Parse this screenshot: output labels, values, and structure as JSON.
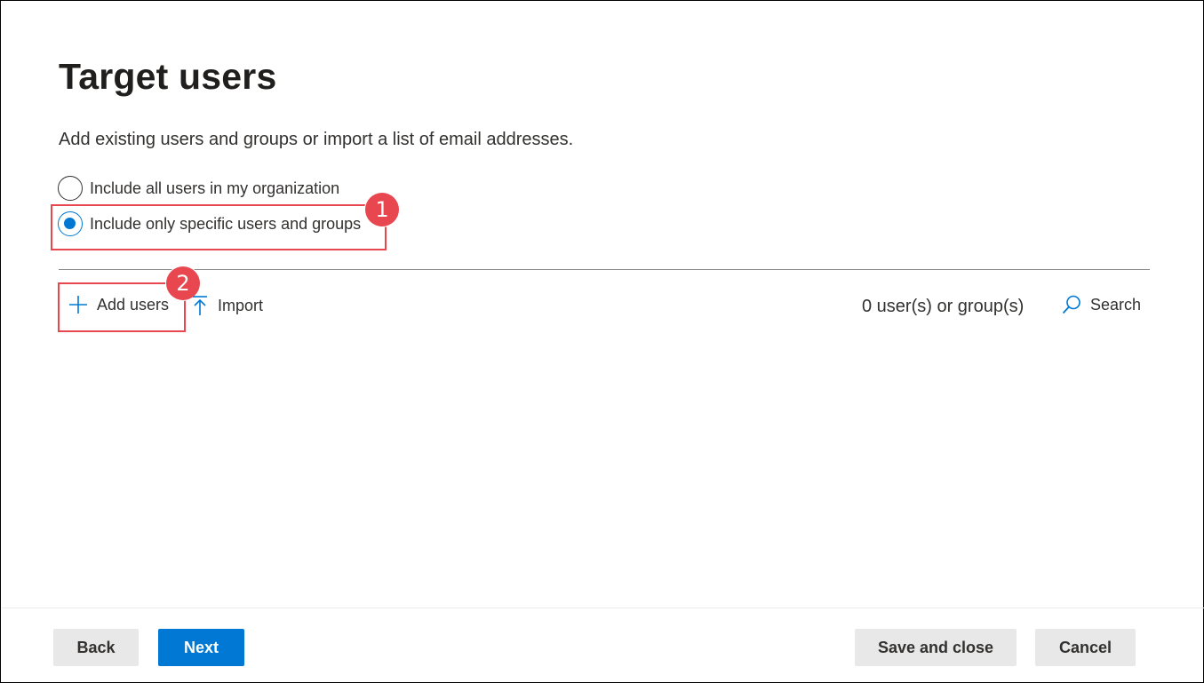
{
  "page": {
    "title": "Target users",
    "description": "Add existing users and groups or import a list of email addresses."
  },
  "options": [
    {
      "label": "Include all users in my organization",
      "selected": false
    },
    {
      "label": "Include only specific users and groups",
      "selected": true
    }
  ],
  "toolbar": {
    "add_users_label": "Add users",
    "import_label": "Import",
    "count_text": "0 user(s) or group(s)",
    "search_label": "Search"
  },
  "annotations": {
    "step1": "1",
    "step2": "2",
    "color": "#e8474f"
  },
  "footer": {
    "back_label": "Back",
    "next_label": "Next",
    "save_label": "Save and close",
    "cancel_label": "Cancel"
  },
  "colors": {
    "accent": "#0078d4",
    "annotation": "#e8474f",
    "secondary_button": "#e8e8e8"
  },
  "icons": {
    "add": "plus-icon",
    "import": "upload-arrow-icon",
    "search": "search-icon"
  }
}
